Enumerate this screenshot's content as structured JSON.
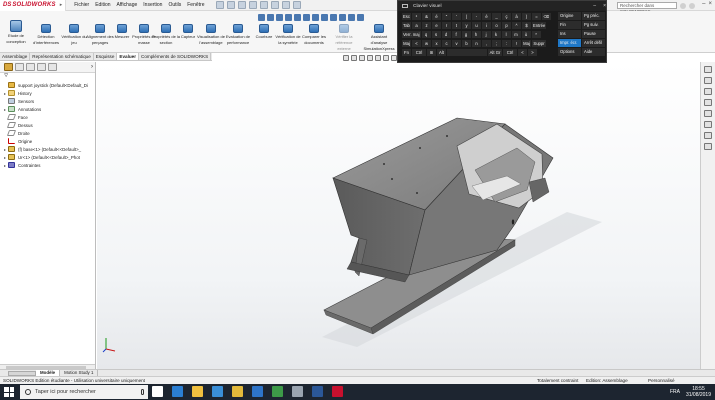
{
  "app": {
    "brand": "SOLIDWORKS",
    "menu": [
      "Fichier",
      "Edition",
      "Affichage",
      "Insertion",
      "Outils",
      "Fenêtre"
    ],
    "search_placeholder": "Rechercher les commandes",
    "search_value": "Rechercher dans SOLIDWORKS"
  },
  "toolbar": {
    "tools": [
      {
        "id": "etude",
        "label": "Etude de conception"
      },
      {
        "id": "detection",
        "label": "Détection d'interférences"
      },
      {
        "id": "verif-jeu",
        "label": "Vérification du jeu"
      },
      {
        "id": "alignement",
        "label": "Alignement des perçages"
      },
      {
        "id": "mesurer",
        "label": "Mesurer"
      },
      {
        "id": "proprietes",
        "label": "Propriétés de masse"
      },
      {
        "id": "prop-section",
        "label": "Propriétés de la section"
      },
      {
        "id": "capteur",
        "label": "Capteur"
      },
      {
        "id": "visualisation",
        "label": "Visualisation de l'assemblage"
      },
      {
        "id": "evaluation",
        "label": "Evaluation de performance"
      },
      {
        "id": "courbure",
        "label": "Courbure"
      },
      {
        "id": "verif-sym",
        "label": "Vérification de la symétrie"
      },
      {
        "id": "comparer",
        "label": "Comparer les documents"
      },
      {
        "id": "reference",
        "label": "Vérifier la référence externe"
      },
      {
        "id": "assistant",
        "label": "Assistant d'analyse SimulationXpress"
      }
    ],
    "tabs": [
      "Assemblage",
      "Représentation schématique",
      "Esquisse",
      "Evaluer",
      "Compléments de SOLIDWORKS"
    ],
    "active_tab": "Evaluer"
  },
  "feature_tree": {
    "filter_icon": "filter-icon",
    "items": [
      {
        "label": "support joystick (Default<Default_Di",
        "icon": "assembly",
        "expand": ""
      },
      {
        "label": "History",
        "icon": "folder",
        "expand": "▸"
      },
      {
        "label": "Sensors",
        "icon": "sensor",
        "expand": ""
      },
      {
        "label": "Annotations",
        "icon": "annot",
        "expand": "▸"
      },
      {
        "label": "Face",
        "icon": "plane",
        "expand": ""
      },
      {
        "label": "Dessus",
        "icon": "plane",
        "expand": ""
      },
      {
        "label": "Droite",
        "icon": "plane",
        "expand": ""
      },
      {
        "label": "Origine",
        "icon": "origin",
        "expand": ""
      },
      {
        "label": "(f) base<1> (Default<<Default>_",
        "icon": "part",
        "expand": "▸"
      },
      {
        "label": "Ur<1> (Default<<Default>_Phot",
        "icon": "part",
        "expand": "▸"
      },
      {
        "label": "Contraintes",
        "icon": "mates",
        "expand": "▸"
      }
    ]
  },
  "bottom_tabs": [
    "Modèle",
    "Motion Study 1"
  ],
  "active_bottom_tab": "Modèle",
  "status": {
    "left": "SOLIDWORKS Edition étudiante - Utilisation universitaire uniquement",
    "constraint": "Totalement contraint",
    "mode": "Edition: Assemblage",
    "custom": "Personnalisé"
  },
  "taskbar": {
    "search_text": "Taper ici pour rechercher",
    "language": "FRA",
    "time": "18:55",
    "date": "31/08/2019",
    "apps": [
      {
        "icon": "task-view-icon",
        "color": "#ffffff"
      },
      {
        "icon": "edge-icon",
        "color": "#2b7fd3"
      },
      {
        "icon": "folder-icon",
        "color": "#f0c040"
      },
      {
        "icon": "store-icon",
        "color": "#3a8fd8"
      },
      {
        "icon": "chrome-icon",
        "color": "#e2b93b"
      },
      {
        "icon": "mail-icon",
        "color": "#2e74c8"
      },
      {
        "icon": "xbox-icon",
        "color": "#3d9a48"
      },
      {
        "icon": "settings-icon",
        "color": "#9aa4b0"
      },
      {
        "icon": "word-icon",
        "color": "#2b5797"
      },
      {
        "icon": "solidworks-icon",
        "color": "#c8102e"
      }
    ]
  },
  "osk": {
    "title": "Clavier visuel",
    "rows": [
      [
        "Esc",
        "²",
        "&",
        "é",
        "\"",
        "'",
        "(",
        "-",
        "è",
        "_",
        "ç",
        "à",
        ")",
        "=",
        "⌫"
      ],
      [
        "Tab",
        "a",
        "z",
        "e",
        "r",
        "t",
        "y",
        "u",
        "i",
        "o",
        "p",
        "^",
        "$",
        "Entrée"
      ],
      [
        "Verr. maj",
        "q",
        "s",
        "d",
        "f",
        "g",
        "h",
        "j",
        "k",
        "l",
        "m",
        "ù",
        "*"
      ],
      [
        "Maj",
        "<",
        "w",
        "x",
        "c",
        "v",
        "b",
        "n",
        ",",
        ";",
        ":",
        "!",
        "Maj",
        "Suppr"
      ],
      [
        "Fn",
        "Ctrl",
        "⊞",
        "Alt",
        "",
        "Alt Gr",
        "Ctrl",
        "<",
        ">"
      ]
    ],
    "side": [
      [
        "Origine",
        "Pg préc."
      ],
      [
        "Fin",
        "Pg suiv."
      ],
      [
        "Ins",
        "Pause"
      ],
      [
        "Impr. écr.",
        "Arrêt défil"
      ],
      [
        "Options",
        "Aide"
      ]
    ],
    "highlight": "Impr. écr."
  }
}
